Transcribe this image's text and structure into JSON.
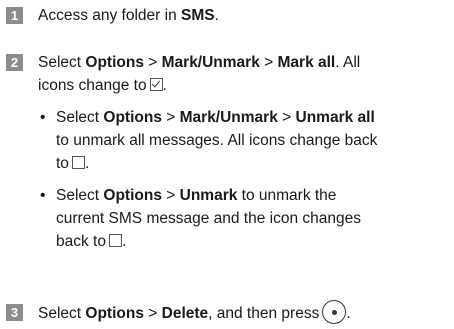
{
  "steps": [
    {
      "number": "1",
      "parts": [
        "Access any folder in ",
        "SMS",
        "."
      ]
    },
    {
      "number": "2",
      "line1": [
        "Select ",
        "Options",
        " > ",
        "Mark/Unmark",
        " > ",
        "Mark all",
        ". All"
      ],
      "line2": [
        "icons change to",
        "."
      ]
    },
    {
      "number": "3",
      "parts": [
        "Select ",
        "Options",
        " > ",
        "Delete",
        ", and then press",
        "."
      ]
    }
  ],
  "bullets": [
    {
      "dot": "•",
      "line1": [
        "Select ",
        "Options",
        " > ",
        "Mark/Unmark",
        " > ",
        "Unmark all"
      ],
      "line2": "to unmark all messages. All icons change back",
      "line3": [
        "to",
        "."
      ]
    },
    {
      "dot": "•",
      "line1": [
        "Select ",
        "Options",
        " > ",
        "Unmark",
        " to unmark the"
      ],
      "line2": "current SMS message and the icon changes",
      "line3": [
        "back to",
        "."
      ]
    }
  ]
}
